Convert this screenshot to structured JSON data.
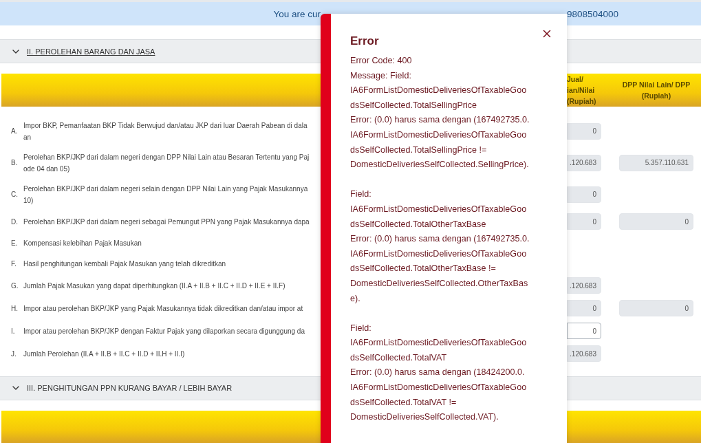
{
  "banner": {
    "text_parts": [
      "You are cur",
      "9808504000"
    ]
  },
  "section_ii": {
    "title": "II. PEROLEHAN BARANG DAN JASA",
    "focused": true
  },
  "table": {
    "columns": [
      {
        "lines": [
          "Jual/",
          "ian/Nilai",
          "(Rupiah)"
        ]
      },
      {
        "lines": [
          "DPP Nilai Lain/ DPP",
          "(Rupiah)"
        ]
      }
    ],
    "rows": [
      {
        "letter": "A.",
        "lines": [
          "Impor BKP, Pemanfaatan BKP Tidak Berwujud dan/atau JKP dari luar Daerah Pabean di dala",
          "an"
        ],
        "col1": {
          "value": "0",
          "editable": false
        }
      },
      {
        "letter": "B.",
        "lines": [
          "Perolehan BKP/JKP dari dalam negeri dengan DPP Nilai Lain atau Besaran Tertentu yang Paj",
          "ode 04 dan 05)"
        ],
        "col1": {
          "value": ".120.683",
          "editable": false
        },
        "col2": {
          "value": "5.357.110.631",
          "editable": false
        }
      },
      {
        "letter": "C.",
        "lines": [
          "Perolehan BKP/JKP dari dalam negeri selain dengan DPP Nilai Lain yang Pajak Masukannya",
          "10)"
        ],
        "col1": {
          "value": "0",
          "editable": false
        }
      },
      {
        "letter": "D.",
        "lines": [
          "Perolehan BKP/JKP dari dalam negeri sebagai Pemungut PPN yang Pajak Masukannya dapa"
        ],
        "col1": {
          "value": "0",
          "editable": false
        },
        "col2": {
          "value": "0",
          "editable": false
        }
      },
      {
        "letter": "E.",
        "lines": [
          "Kompensasi kelebihan Pajak Masukan"
        ]
      },
      {
        "letter": "F.",
        "lines": [
          "Hasil penghitungan kembali Pajak Masukan yang telah dikreditkan"
        ]
      },
      {
        "letter": "G.",
        "lines": [
          "Jumlah Pajak Masukan yang dapat diperhitungkan (II.A + II.B + II.C + II.D + II.E + II.F)"
        ],
        "col1": {
          "value": ".120.683",
          "editable": false
        }
      },
      {
        "letter": "H.",
        "lines": [
          "Impor atau perolehan BKP/JKP yang Pajak Masukannya tidak dikreditkan dan/atau impor at"
        ],
        "col1": {
          "value": "0",
          "editable": false
        },
        "col2": {
          "value": "0",
          "editable": false
        }
      },
      {
        "letter": "I.",
        "lines": [
          "Impor atau perolehan BKP/JKP dengan Faktur Pajak yang dilaporkan secara digunggung da"
        ],
        "col1": {
          "value": "0",
          "editable": true
        }
      },
      {
        "letter": "J.",
        "lines": [
          "Jumlah Perolehan (II.A + II.B + II.C + II.D + II.H + II.I)"
        ],
        "col1": {
          "value": ".120.683",
          "editable": false
        }
      }
    ]
  },
  "section_iii": {
    "title": "III. PENGHITUNGAN PPN KURANG BAYAR / LEBIH BAYAR",
    "focused": false
  },
  "dialog": {
    "title": "Error",
    "blocks": [
      [
        "Error Code: 400",
        "Message: Field:",
        "IA6FormListDomesticDeliveriesOfTaxableGoo",
        "dsSelfCollected.TotalSellingPrice",
        "Error: (0.0) harus sama dengan (167492735.0.",
        "IA6FormListDomesticDeliveriesOfTaxableGoo",
        "dsSelfCollected.TotalSellingPrice !=",
        "DomesticDeliveriesSelfCollected.SellingPrice)."
      ],
      [
        "Field:",
        "IA6FormListDomesticDeliveriesOfTaxableGoo",
        "dsSelfCollected.TotalOtherTaxBase",
        "Error: (0.0) harus sama dengan (167492735.0.",
        "IA6FormListDomesticDeliveriesOfTaxableGoo",
        "dsSelfCollected.TotalOtherTaxBase !=",
        "DomesticDeliveriesSelfCollected.OtherTaxBas",
        "e)."
      ],
      [
        "Field:",
        "IA6FormListDomesticDeliveriesOfTaxableGoo",
        "dsSelfCollected.TotalVAT",
        "Error: (0.0) harus sama dengan (18424200.0.",
        "IA6FormListDomesticDeliveriesOfTaxableGoo",
        "dsSelfCollected.TotalVAT !=",
        "DomesticDeliveriesSelfCollected.VAT)."
      ]
    ]
  }
}
